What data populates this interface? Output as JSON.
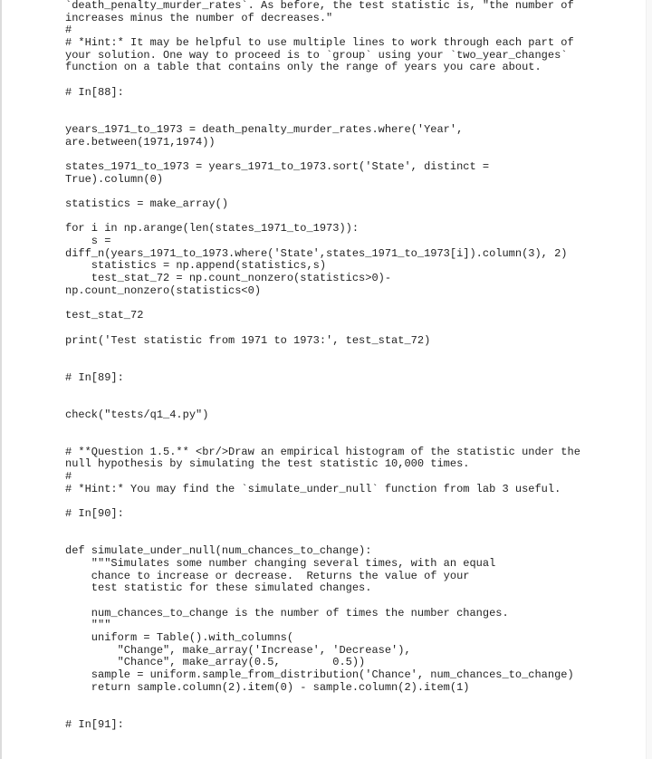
{
  "document": {
    "lines": [
      "`death_penalty_murder_rates`. As before, the test statistic is, \"the number of",
      "increases minus the number of decreases.\"",
      "#",
      "# *Hint:* It may be helpful to use multiple lines to work through each part of",
      "your solution. One way to proceed is to `group` using your `two_year_changes`",
      "function on a table that contains only the range of years you care about.",
      "",
      "# In[88]:",
      "",
      "",
      "years_1971_to_1973 = death_penalty_murder_rates.where('Year',",
      "are.between(1971,1974))",
      "",
      "states_1971_to_1973 = years_1971_to_1973.sort('State', distinct =",
      "True).column(0)",
      "",
      "statistics = make_array()",
      "",
      "for i in np.arange(len(states_1971_to_1973)):",
      "    s =",
      "diff_n(years_1971_to_1973.where('State',states_1971_to_1973[i]).column(3), 2)",
      "    statistics = np.append(statistics,s)",
      "    test_stat_72 = np.count_nonzero(statistics>0)-",
      "np.count_nonzero(statistics<0)",
      "",
      "test_stat_72",
      "",
      "print('Test statistic from 1971 to 1973:', test_stat_72)",
      "",
      "",
      "# In[89]:",
      "",
      "",
      "check(\"tests/q1_4.py\")",
      "",
      "",
      "# **Question 1.5.** <br/>Draw an empirical histogram of the statistic under the",
      "null hypothesis by simulating the test statistic 10,000 times.",
      "#",
      "# *Hint:* You may find the `simulate_under_null` function from lab 3 useful.",
      "",
      "# In[90]:",
      "",
      "",
      "def simulate_under_null(num_chances_to_change):",
      "    \"\"\"Simulates some number changing several times, with an equal",
      "    chance to increase or decrease.  Returns the value of your",
      "    test statistic for these simulated changes.",
      "",
      "    num_chances_to_change is the number of times the number changes.",
      "    \"\"\"",
      "    uniform = Table().with_columns(",
      "        \"Change\", make_array('Increase', 'Decrease'),",
      "        \"Chance\", make_array(0.5,        0.5))",
      "    sample = uniform.sample_from_distribution('Chance', num_chances_to_change)",
      "    return sample.column(2).item(0) - sample.column(2).item(1)",
      "",
      "",
      "# In[91]:"
    ]
  }
}
